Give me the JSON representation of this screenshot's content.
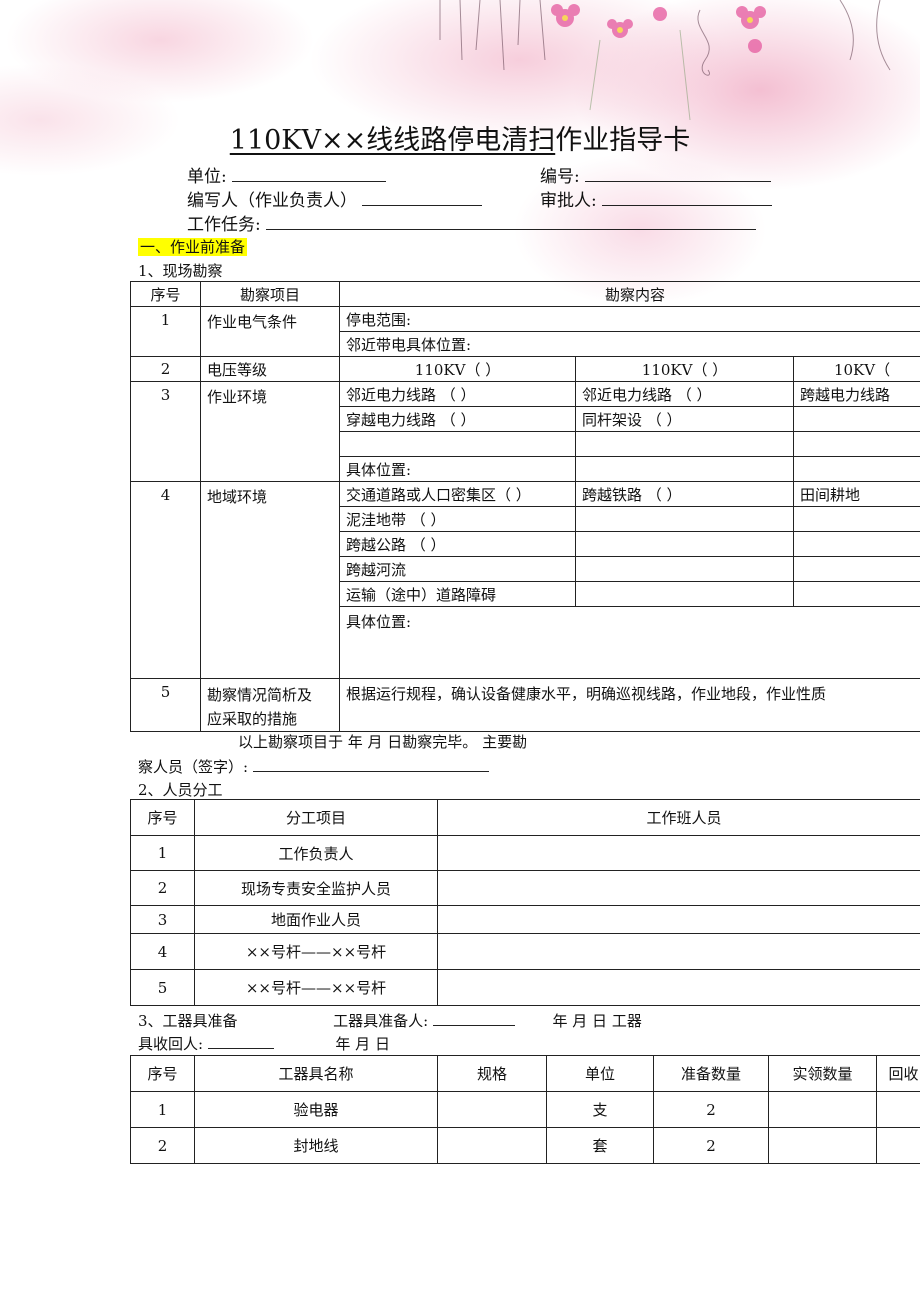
{
  "title": {
    "underlined": "110KV××线线路停电清扫",
    "rest": "作业指导卡"
  },
  "header": {
    "unit_label": "单位:",
    "number_label": "编号:",
    "author_label": "编写人（作业负责人）",
    "approver_label": "审批人:",
    "task_label": "工作任务:"
  },
  "section1": {
    "heading": "一、作业前准备",
    "survey_heading": "1、现场勘察",
    "survey_table": {
      "headers": [
        "序号",
        "勘察项目",
        "勘察内容"
      ],
      "r1_no": "1",
      "r1_item": "作业电气条件",
      "r1_line1": "停电范围:",
      "r1_line2": "邻近带电具体位置:",
      "r2_no": "2",
      "r2_item": "电压等级",
      "r2_v1": "110KV（    ）",
      "r2_v2": "110KV（    ）",
      "r2_v3": "10KV（",
      "r3_no": "3",
      "r3_item": "作业环境",
      "r3_a1": "邻近电力线路     （    ）",
      "r3_a2": "邻近电力线路       （    ）",
      "r3_a3": "跨越电力线路",
      "r3_b1": "穿越电力线路     （    ）",
      "r3_b2": "同杆架设             （    ）",
      "r3_loc": "具体位置:",
      "r4_no": "4",
      "r4_item": "地域环境",
      "r4_a1": "交通道路或人口密集区（  ）",
      "r4_a2": "跨越铁路            （    ）",
      "r4_a3": "田间耕地",
      "r4_b1": "泥洼地带          （    ）",
      "r4_c1": "跨越公路          （    ）",
      "r4_d1": "跨越河流",
      "r4_e1": "运输（途中）道路障碍",
      "r4_loc": "具体位置:",
      "r5_no": "5",
      "r5_item_1": "勘察情况简析及",
      "r5_item_2": "应采取的措施",
      "r5_content": "根据运行规程，确认设备健康水平，明确巡视线路，作业地段，作业性质"
    },
    "survey_done": "以上勘察项目于              年        月        日勘察完毕。                    主要勘",
    "survey_sign": "察人员（签字）:",
    "staff_heading": "2、人员分工",
    "staff_table": {
      "headers": [
        "序号",
        "分工项目",
        "工作班人员"
      ],
      "rows": [
        [
          "1",
          "工作负责人"
        ],
        [
          "2",
          "现场专责安全监护人员"
        ],
        [
          "3",
          "地面作业人员"
        ],
        [
          "4",
          "××号杆——××号杆"
        ],
        [
          "5",
          "××号杆——××号杆"
        ]
      ]
    },
    "tools_line1_a": "3、工器具准备",
    "tools_line1_b": "工器具准备人:",
    "tools_line1_c": "年        月        日                工器",
    "tools_line2_a": "具收回人:",
    "tools_line2_b": "年        月        日",
    "tools_table": {
      "headers": [
        "序号",
        "工器具名称",
        "规格",
        "单位",
        "准备数量",
        "实领数量",
        "回收"
      ],
      "rows": [
        [
          "1",
          "验电器",
          "",
          "支",
          "2",
          "",
          ""
        ],
        [
          "2",
          "封地线",
          "",
          "套",
          "2",
          "",
          ""
        ]
      ]
    }
  }
}
